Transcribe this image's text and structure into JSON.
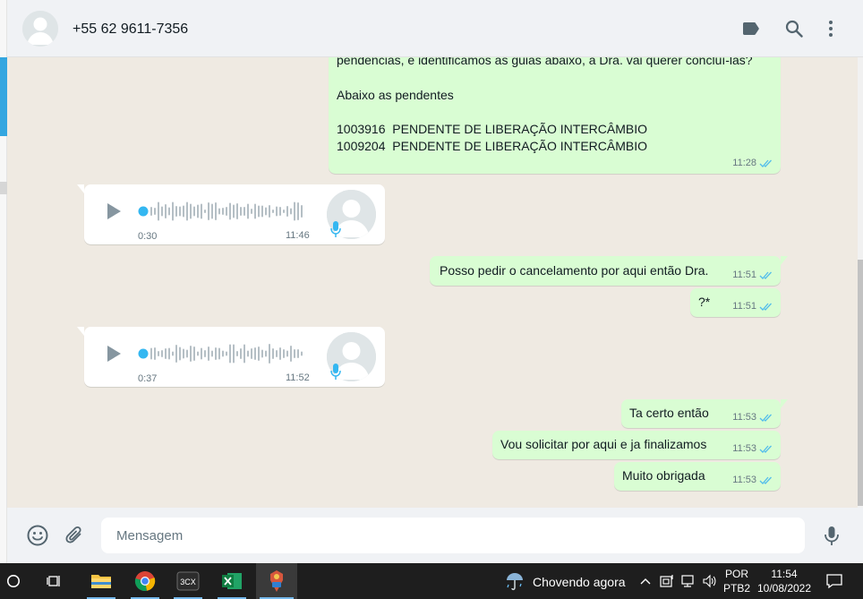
{
  "header": {
    "contact_name": "+55 62 9611-7356",
    "icons": [
      "label-icon",
      "search-icon",
      "more-options-icon"
    ]
  },
  "messages": [
    {
      "type": "text",
      "direction": "outgoing",
      "partial_line": "pendências, e identificamos as guias abaixo, a Dra. vai querer concluí-las?",
      "lines": [
        "Abaixo as pendentes",
        "",
        "1003916  PENDENTE DE LIBERAÇÃO INTERCÂMBIO",
        "1009204  PENDENTE DE LIBERAÇÃO INTERCÂMBIO"
      ],
      "time": "11:28",
      "status": "read"
    },
    {
      "type": "audio",
      "direction": "incoming",
      "duration": "0:30",
      "time": "11:46"
    },
    {
      "type": "text",
      "direction": "outgoing",
      "text": "Posso pedir o cancelamento por aqui então Dra.",
      "time": "11:51",
      "status": "read"
    },
    {
      "type": "text",
      "direction": "outgoing",
      "text": "?*",
      "time": "11:51",
      "status": "read"
    },
    {
      "type": "audio",
      "direction": "incoming",
      "duration": "0:37",
      "time": "11:52"
    },
    {
      "type": "text",
      "direction": "outgoing",
      "text": "Ta certo então",
      "time": "11:53",
      "status": "read"
    },
    {
      "type": "text",
      "direction": "outgoing",
      "text": "Vou solicitar por aqui e ja finalizamos",
      "time": "11:53",
      "status": "read"
    },
    {
      "type": "text",
      "direction": "outgoing",
      "text": "Muito obrigada",
      "time": "11:53",
      "status": "read"
    }
  ],
  "composer": {
    "placeholder": "Mensagem",
    "icons": [
      "emoji-icon",
      "attach-icon",
      "microphone-icon"
    ]
  },
  "taskbar": {
    "apps": [
      "start-button",
      "task-view-icon",
      "file-explorer-icon",
      "chrome-icon",
      "3cx-icon",
      "excel-icon",
      "active-app-icon"
    ],
    "app_3cx_label": "3CX",
    "weather": "Chovendo agora",
    "language_line1": "POR",
    "language_line2": "PTB2",
    "time": "11:54",
    "date": "10/08/2022"
  },
  "colors": {
    "outgoing_bubble": "#d9fdd3",
    "incoming_bubble": "#ffffff",
    "chat_background": "#efeae2",
    "read_ticks": "#53bdeb",
    "audio_accent": "#34b7f1"
  }
}
